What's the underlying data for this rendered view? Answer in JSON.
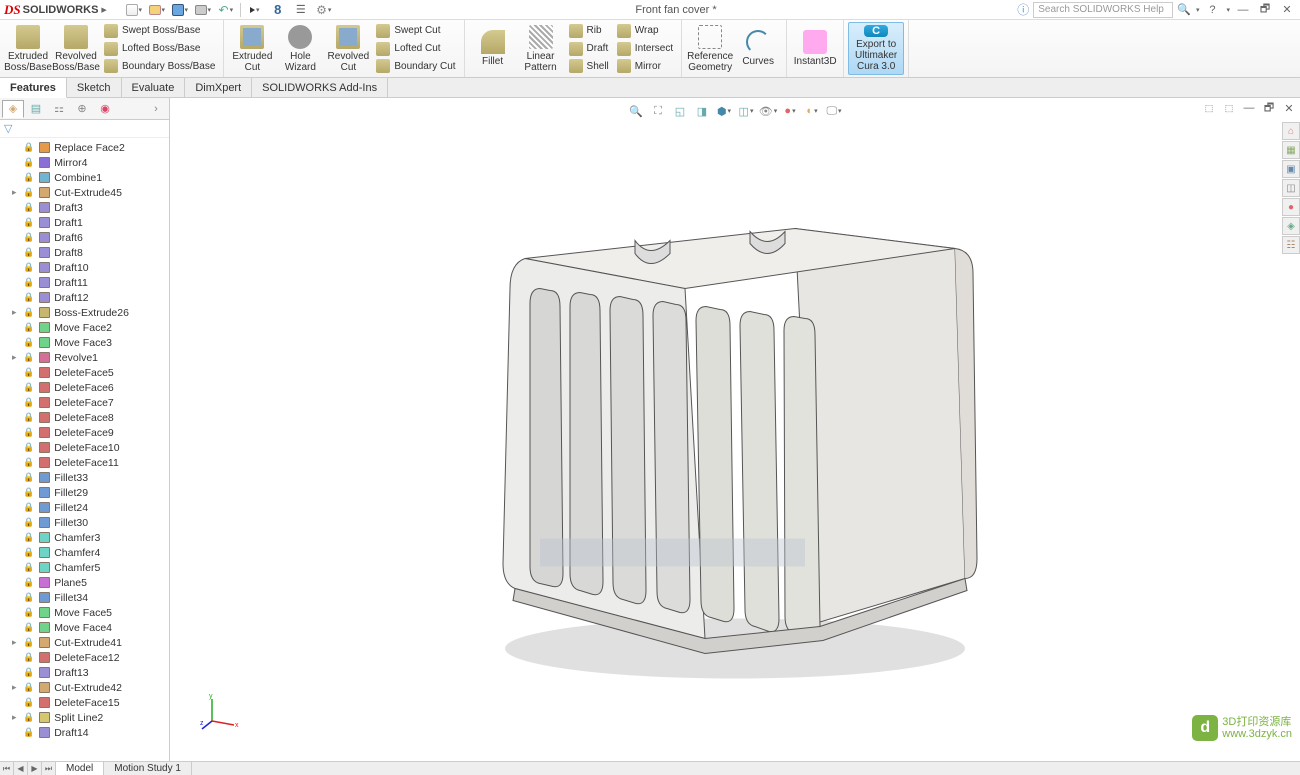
{
  "app": {
    "logo_prefix": "DS",
    "logo_name": "SOLIDWORKS",
    "document_title": "Front fan cover *",
    "search_placeholder": "Search SOLIDWORKS Help",
    "help_glyph": "?"
  },
  "qat": {
    "items": [
      "new",
      "open",
      "save",
      "print",
      "undo",
      "select",
      "rebuild",
      "options",
      "settings"
    ]
  },
  "ribbon": {
    "tabs": [
      "Features",
      "Sketch",
      "Evaluate",
      "DimXpert",
      "SOLIDWORKS Add-Ins"
    ],
    "active_tab": "Features",
    "groups": [
      {
        "big": [
          {
            "label": "Extruded Boss/Base",
            "icon": "ext"
          },
          {
            "label": "Revolved Boss/Base",
            "icon": "ext"
          }
        ],
        "small": [
          "Swept Boss/Base",
          "Lofted Boss/Base",
          "Boundary Boss/Base"
        ]
      },
      {
        "big": [
          {
            "label": "Extruded Cut",
            "icon": "cut"
          },
          {
            "label": "Hole Wizard",
            "icon": "hole"
          },
          {
            "label": "Revolved Cut",
            "icon": "cut"
          }
        ],
        "small": [
          "Swept Cut",
          "Lofted Cut",
          "Boundary Cut"
        ]
      },
      {
        "big": [
          {
            "label": "Fillet",
            "icon": "fillet"
          },
          {
            "label": "Linear Pattern",
            "icon": "pattern"
          }
        ],
        "small_cols": [
          [
            "Rib",
            "Draft",
            "Shell"
          ],
          [
            "Wrap",
            "Intersect",
            "Mirror"
          ]
        ]
      },
      {
        "big": [
          {
            "label": "Reference Geometry",
            "icon": "ref"
          },
          {
            "label": "Curves",
            "icon": "curve"
          }
        ]
      },
      {
        "big": [
          {
            "label": "Instant3D",
            "icon": "instant"
          }
        ]
      },
      {
        "big": [
          {
            "label": "Export to Ultimaker Cura 3.0",
            "icon": "cura",
            "highlighted": true
          }
        ]
      }
    ]
  },
  "fm_tree": [
    {
      "name": "Replace Face2",
      "type": "face"
    },
    {
      "name": "Mirror4",
      "type": "mirror"
    },
    {
      "name": "Combine1",
      "type": "combine"
    },
    {
      "name": "Cut-Extrude45",
      "type": "cut",
      "expandable": true
    },
    {
      "name": "Draft3",
      "type": "draft"
    },
    {
      "name": "Draft1",
      "type": "draft"
    },
    {
      "name": "Draft6",
      "type": "draft"
    },
    {
      "name": "Draft8",
      "type": "draft"
    },
    {
      "name": "Draft10",
      "type": "draft"
    },
    {
      "name": "Draft11",
      "type": "draft"
    },
    {
      "name": "Draft12",
      "type": "draft"
    },
    {
      "name": "Boss-Extrude26",
      "type": "ext",
      "expandable": true
    },
    {
      "name": "Move Face2",
      "type": "move"
    },
    {
      "name": "Move Face3",
      "type": "move"
    },
    {
      "name": "Revolve1",
      "type": "rev",
      "expandable": true
    },
    {
      "name": "DeleteFace5",
      "type": "del"
    },
    {
      "name": "DeleteFace6",
      "type": "del"
    },
    {
      "name": "DeleteFace7",
      "type": "del"
    },
    {
      "name": "DeleteFace8",
      "type": "del"
    },
    {
      "name": "DeleteFace9",
      "type": "del"
    },
    {
      "name": "DeleteFace10",
      "type": "del"
    },
    {
      "name": "DeleteFace11",
      "type": "del"
    },
    {
      "name": "Fillet33",
      "type": "fillet"
    },
    {
      "name": "Fillet29",
      "type": "fillet"
    },
    {
      "name": "Fillet24",
      "type": "fillet"
    },
    {
      "name": "Fillet30",
      "type": "fillet"
    },
    {
      "name": "Chamfer3",
      "type": "chamfer"
    },
    {
      "name": "Chamfer4",
      "type": "chamfer"
    },
    {
      "name": "Chamfer5",
      "type": "chamfer"
    },
    {
      "name": "Plane5",
      "type": "plane"
    },
    {
      "name": "Fillet34",
      "type": "fillet"
    },
    {
      "name": "Move Face5",
      "type": "move"
    },
    {
      "name": "Move Face4",
      "type": "move"
    },
    {
      "name": "Cut-Extrude41",
      "type": "cut",
      "expandable": true
    },
    {
      "name": "DeleteFace12",
      "type": "del"
    },
    {
      "name": "Draft13",
      "type": "draft"
    },
    {
      "name": "Cut-Extrude42",
      "type": "cut",
      "expandable": true
    },
    {
      "name": "DeleteFace15",
      "type": "del"
    },
    {
      "name": "Split Line2",
      "type": "split",
      "expandable": true
    },
    {
      "name": "Draft14",
      "type": "draft"
    }
  ],
  "feature_colors": {
    "face": "#e59a4a",
    "mirror": "#8a6fd4",
    "combine": "#6fb5d4",
    "cut": "#d4a96f",
    "draft": "#9a8fd4",
    "ext": "#c8b56f",
    "move": "#6fd48a",
    "rev": "#d46f9a",
    "del": "#d46f6f",
    "fillet": "#6f9ad4",
    "chamfer": "#6fd4c8",
    "plane": "#c86fd4",
    "split": "#d4c86f"
  },
  "bottom_tabs": [
    "Model",
    "Motion Study 1"
  ],
  "triad": {
    "x": "x",
    "y": "y",
    "z": "z"
  },
  "attribution": {
    "badge": "d",
    "line1": "3D打印资源库",
    "line2": "www.3dzyk.cn"
  }
}
